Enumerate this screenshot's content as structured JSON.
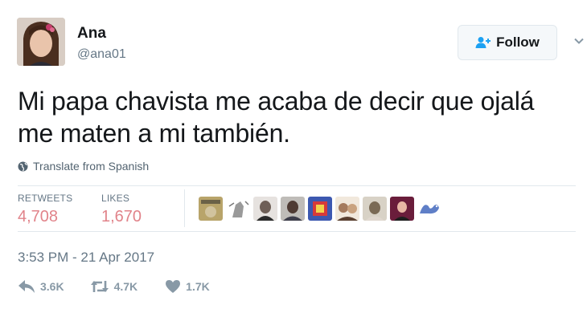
{
  "user": {
    "name": "Ana",
    "handle": "@ana01"
  },
  "follow": {
    "label": "Follow"
  },
  "tweet": {
    "text_line1": "Mi papa chavista me acaba de decir que ojalá",
    "text_line2": "me maten a mi también.",
    "translate_label": "Translate from Spanish"
  },
  "stats": {
    "retweets_label": "RETWEETS",
    "retweets_value": "4,708",
    "likes_label": "LIKES",
    "likes_value": "1,670",
    "liker_colors": [
      "#b8a46a",
      "#9a9a9a",
      "#6e5f57",
      "#4e3a33",
      "#3c58b0",
      "#a57b5e",
      "#7a6a55",
      "#6a1d3b",
      "#5f7fc7"
    ]
  },
  "timestamp": "3:53 PM - 21 Apr 2017",
  "actions": {
    "reply_count": "3.6K",
    "retweet_count": "4.7K",
    "like_count": "1.7K"
  },
  "colors": {
    "stat_value": "#e1838a",
    "muted": "#657786",
    "text": "#14171a"
  }
}
